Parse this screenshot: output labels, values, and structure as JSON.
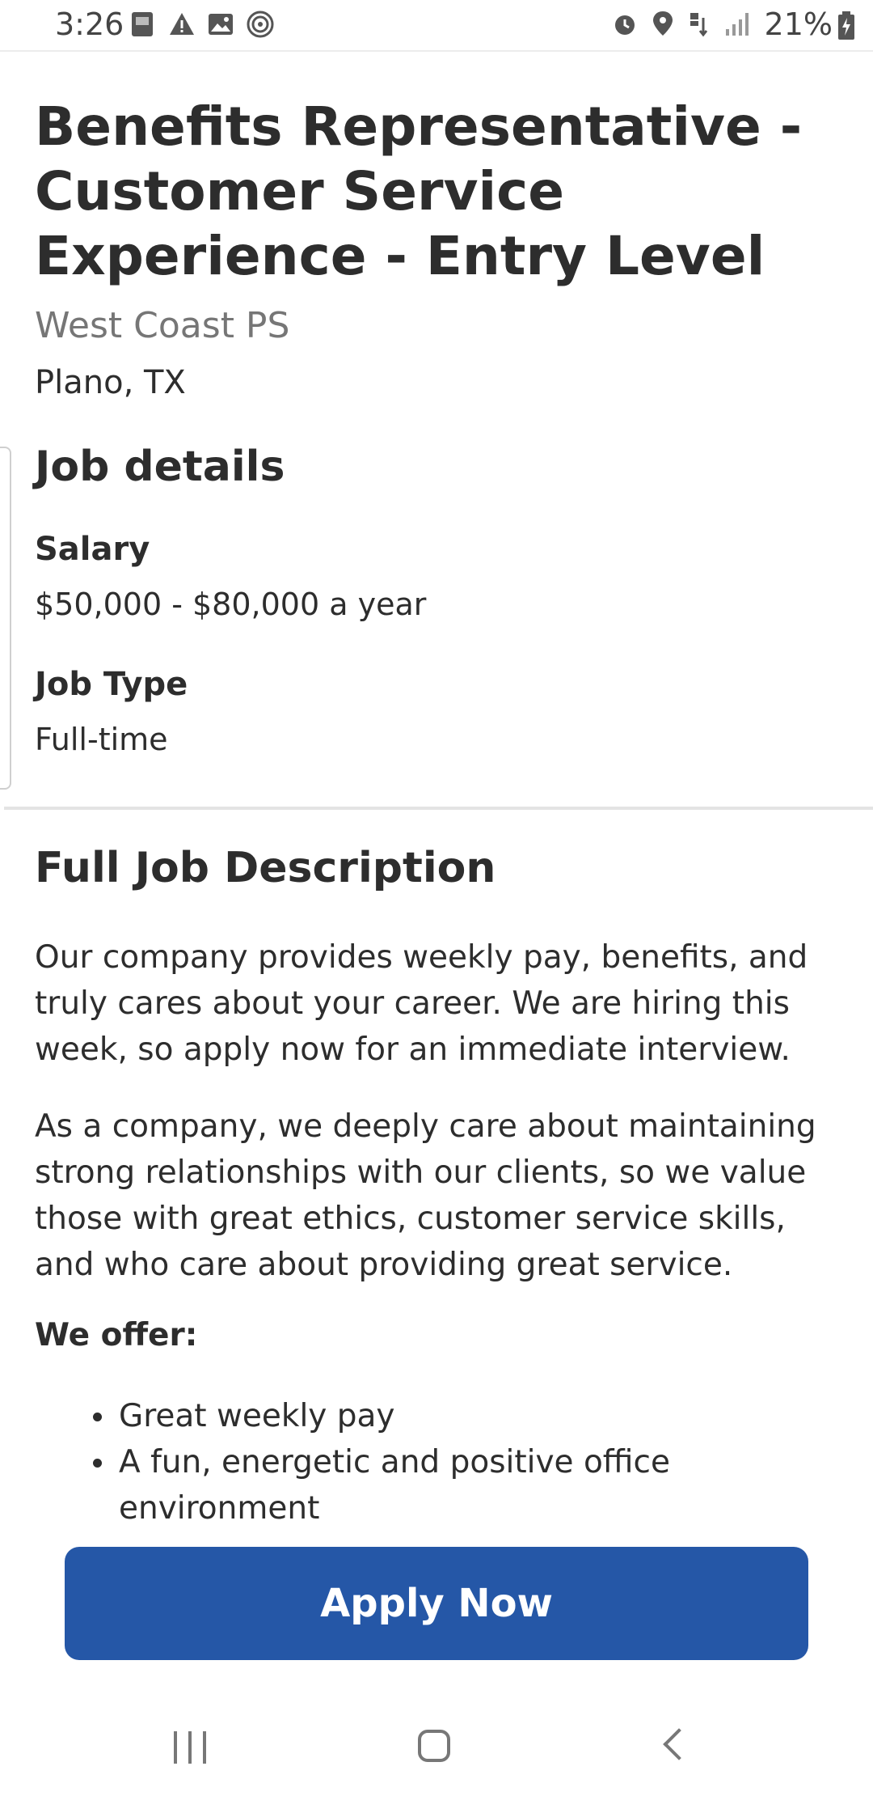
{
  "status_bar": {
    "time": "3:26",
    "battery_percent": "21%",
    "left_icons": [
      "bible-app-icon",
      "warning-icon",
      "image-icon",
      "fingerprint-icon"
    ],
    "right_icons": [
      "alarm-icon",
      "location-icon",
      "4g-lte-icon",
      "signal-icon",
      "battery-charging-icon"
    ]
  },
  "job": {
    "title": "Benefits Representative - Customer Service Experience - Entry Level",
    "company": "West Coast PS",
    "location": "Plano, TX"
  },
  "job_details": {
    "heading": "Job details",
    "salary_label": "Salary",
    "salary_value": "$50,000 - $80,000 a year",
    "job_type_label": "Job Type",
    "job_type_value": "Full-time"
  },
  "description": {
    "heading": "Full Job Description",
    "paragraphs": [
      "Our company provides weekly pay, benefits, and truly cares about your career. We are hiring this week, so apply now for an immediate interview.",
      "As a company, we deeply care about maintaining strong relationships with our clients, so we value those with great ethics, customer service skills, and who care about providing great service."
    ],
    "offer_heading": "We offer:",
    "offer_items": [
      "Great weekly pay",
      "A fun, energetic and positive office environment"
    ]
  },
  "apply_button": {
    "label": "Apply Now"
  },
  "colors": {
    "accent": "#2557a7",
    "text": "#2d2d2d",
    "muted": "#767676"
  },
  "nav_bar": {
    "icons": [
      "recent-apps-icon",
      "home-icon",
      "back-icon"
    ]
  }
}
